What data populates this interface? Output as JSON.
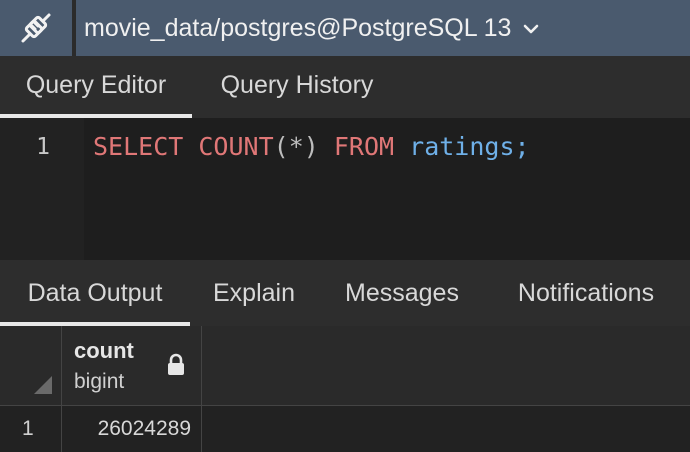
{
  "connection": {
    "label": "movie_data/postgres@PostgreSQL 13",
    "icon": "connect-plug-icon",
    "dropdown_icon": "chevron-down-icon"
  },
  "editor_tabs": [
    "Query Editor",
    "Query History"
  ],
  "editor": {
    "line_number": "1",
    "tokens": {
      "select": "SELECT",
      "count": "COUNT",
      "paren": "(*)",
      "from": "FROM",
      "table": "ratings",
      "semicolon": ";"
    }
  },
  "output_tabs": [
    "Data Output",
    "Explain",
    "Messages",
    "Notifications"
  ],
  "grid": {
    "column": {
      "name": "count",
      "type": "bigint",
      "lock_icon": "lock-icon"
    },
    "rows": [
      {
        "num": "1",
        "value": "26024289"
      }
    ]
  },
  "colors": {
    "accent_bar": "#4a5a6e",
    "keyword": "#e07777",
    "identifier": "#6fb0e8"
  }
}
